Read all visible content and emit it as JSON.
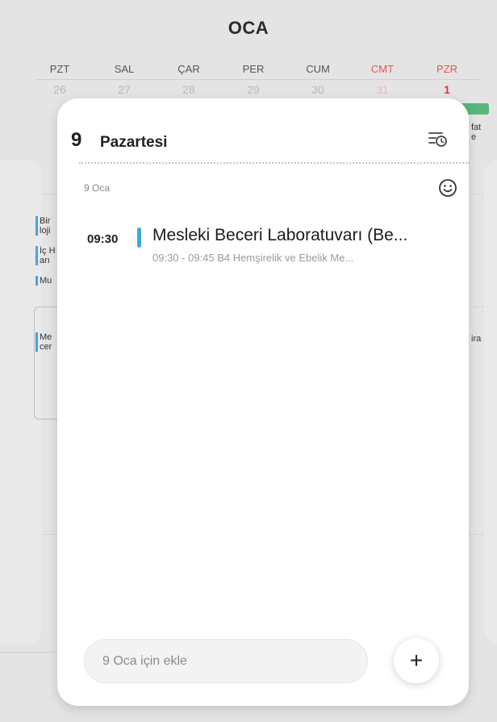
{
  "calendar": {
    "month": "OCA",
    "weekdays": [
      "PZT",
      "SAL",
      "ÇAR",
      "PER",
      "CUM",
      "CMT",
      "PZR"
    ],
    "dates": [
      "26",
      "27",
      "28",
      "29",
      "30",
      "31",
      "1"
    ],
    "weekend_color": "#e25555",
    "accent_green": "#58b77b",
    "background_events": {
      "right_top": "fat\ne",
      "left_1": "Bir\nloji",
      "left_2": "İç H\narı",
      "left_3": "Mu",
      "left_4": "Me\ncer",
      "right_mid": "ira"
    }
  },
  "day_sheet": {
    "day_number": "9",
    "day_name": "Pazartesi",
    "date_small": "9 Oca",
    "events": [
      {
        "time": "09:30",
        "title": "Mesleki Beceri Laboratuvarı (Be...",
        "subtitle": "09:30 - 09:45  B4 Hemşirelik ve Ebelik Me...",
        "color": "#3fa6dc"
      }
    ],
    "add_placeholder": "9 Oca için ekle",
    "add_button": "+"
  }
}
